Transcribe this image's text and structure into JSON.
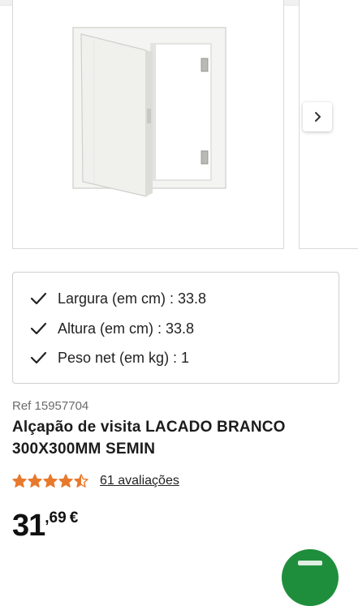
{
  "gallery": {
    "next_icon": "chevron-right-icon"
  },
  "features": [
    {
      "label": "Largura (em cm) : 33.8"
    },
    {
      "label": "Altura (em cm) : 33.8"
    },
    {
      "label": "Peso net (em kg) : 1"
    }
  ],
  "product": {
    "ref": "Ref 15957704",
    "title_line1": "Alçapão de visita LACADO BRANCO",
    "title_line2": "300X300MM SEMIN",
    "rating": 4.5,
    "rating_max": 5,
    "reviews": "61 avaliações",
    "price_int": "31",
    "price_dec": ",69",
    "currency": "€"
  },
  "colors": {
    "star": "#e8792c",
    "fab": "#1f8e3c",
    "border": "#d9d9d9"
  }
}
